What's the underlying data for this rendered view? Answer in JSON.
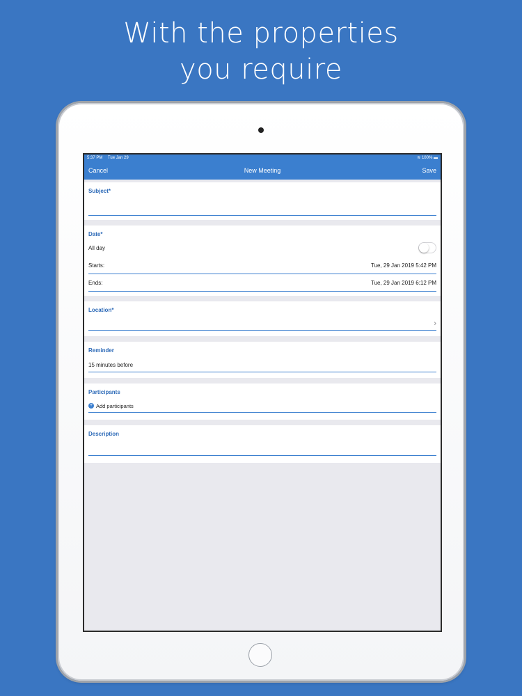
{
  "headline": {
    "line1": "With the properties",
    "line2": "you require"
  },
  "status": {
    "time": "5:37 PM",
    "date": "Tue Jan 29",
    "battery": "100%"
  },
  "nav": {
    "cancel": "Cancel",
    "title": "New Meeting",
    "save": "Save"
  },
  "subject": {
    "label": "Subject*",
    "value": ""
  },
  "date": {
    "label": "Date*",
    "all_day_label": "All day",
    "all_day_on": false,
    "starts_label": "Starts:",
    "starts_value": "Tue, 29 Jan 2019 5:42 PM",
    "ends_label": "Ends:",
    "ends_value": "Tue, 29 Jan 2019 6:12 PM"
  },
  "location": {
    "label": "Location*",
    "value": ""
  },
  "reminder": {
    "label": "Reminder",
    "value": "15 minutes before"
  },
  "participants": {
    "label": "Participants",
    "add_label": "Add participants"
  },
  "description": {
    "label": "Description",
    "value": ""
  },
  "colors": {
    "background": "#3a76c2",
    "accent": "#3b7fcf",
    "label": "#2e6bb8"
  }
}
